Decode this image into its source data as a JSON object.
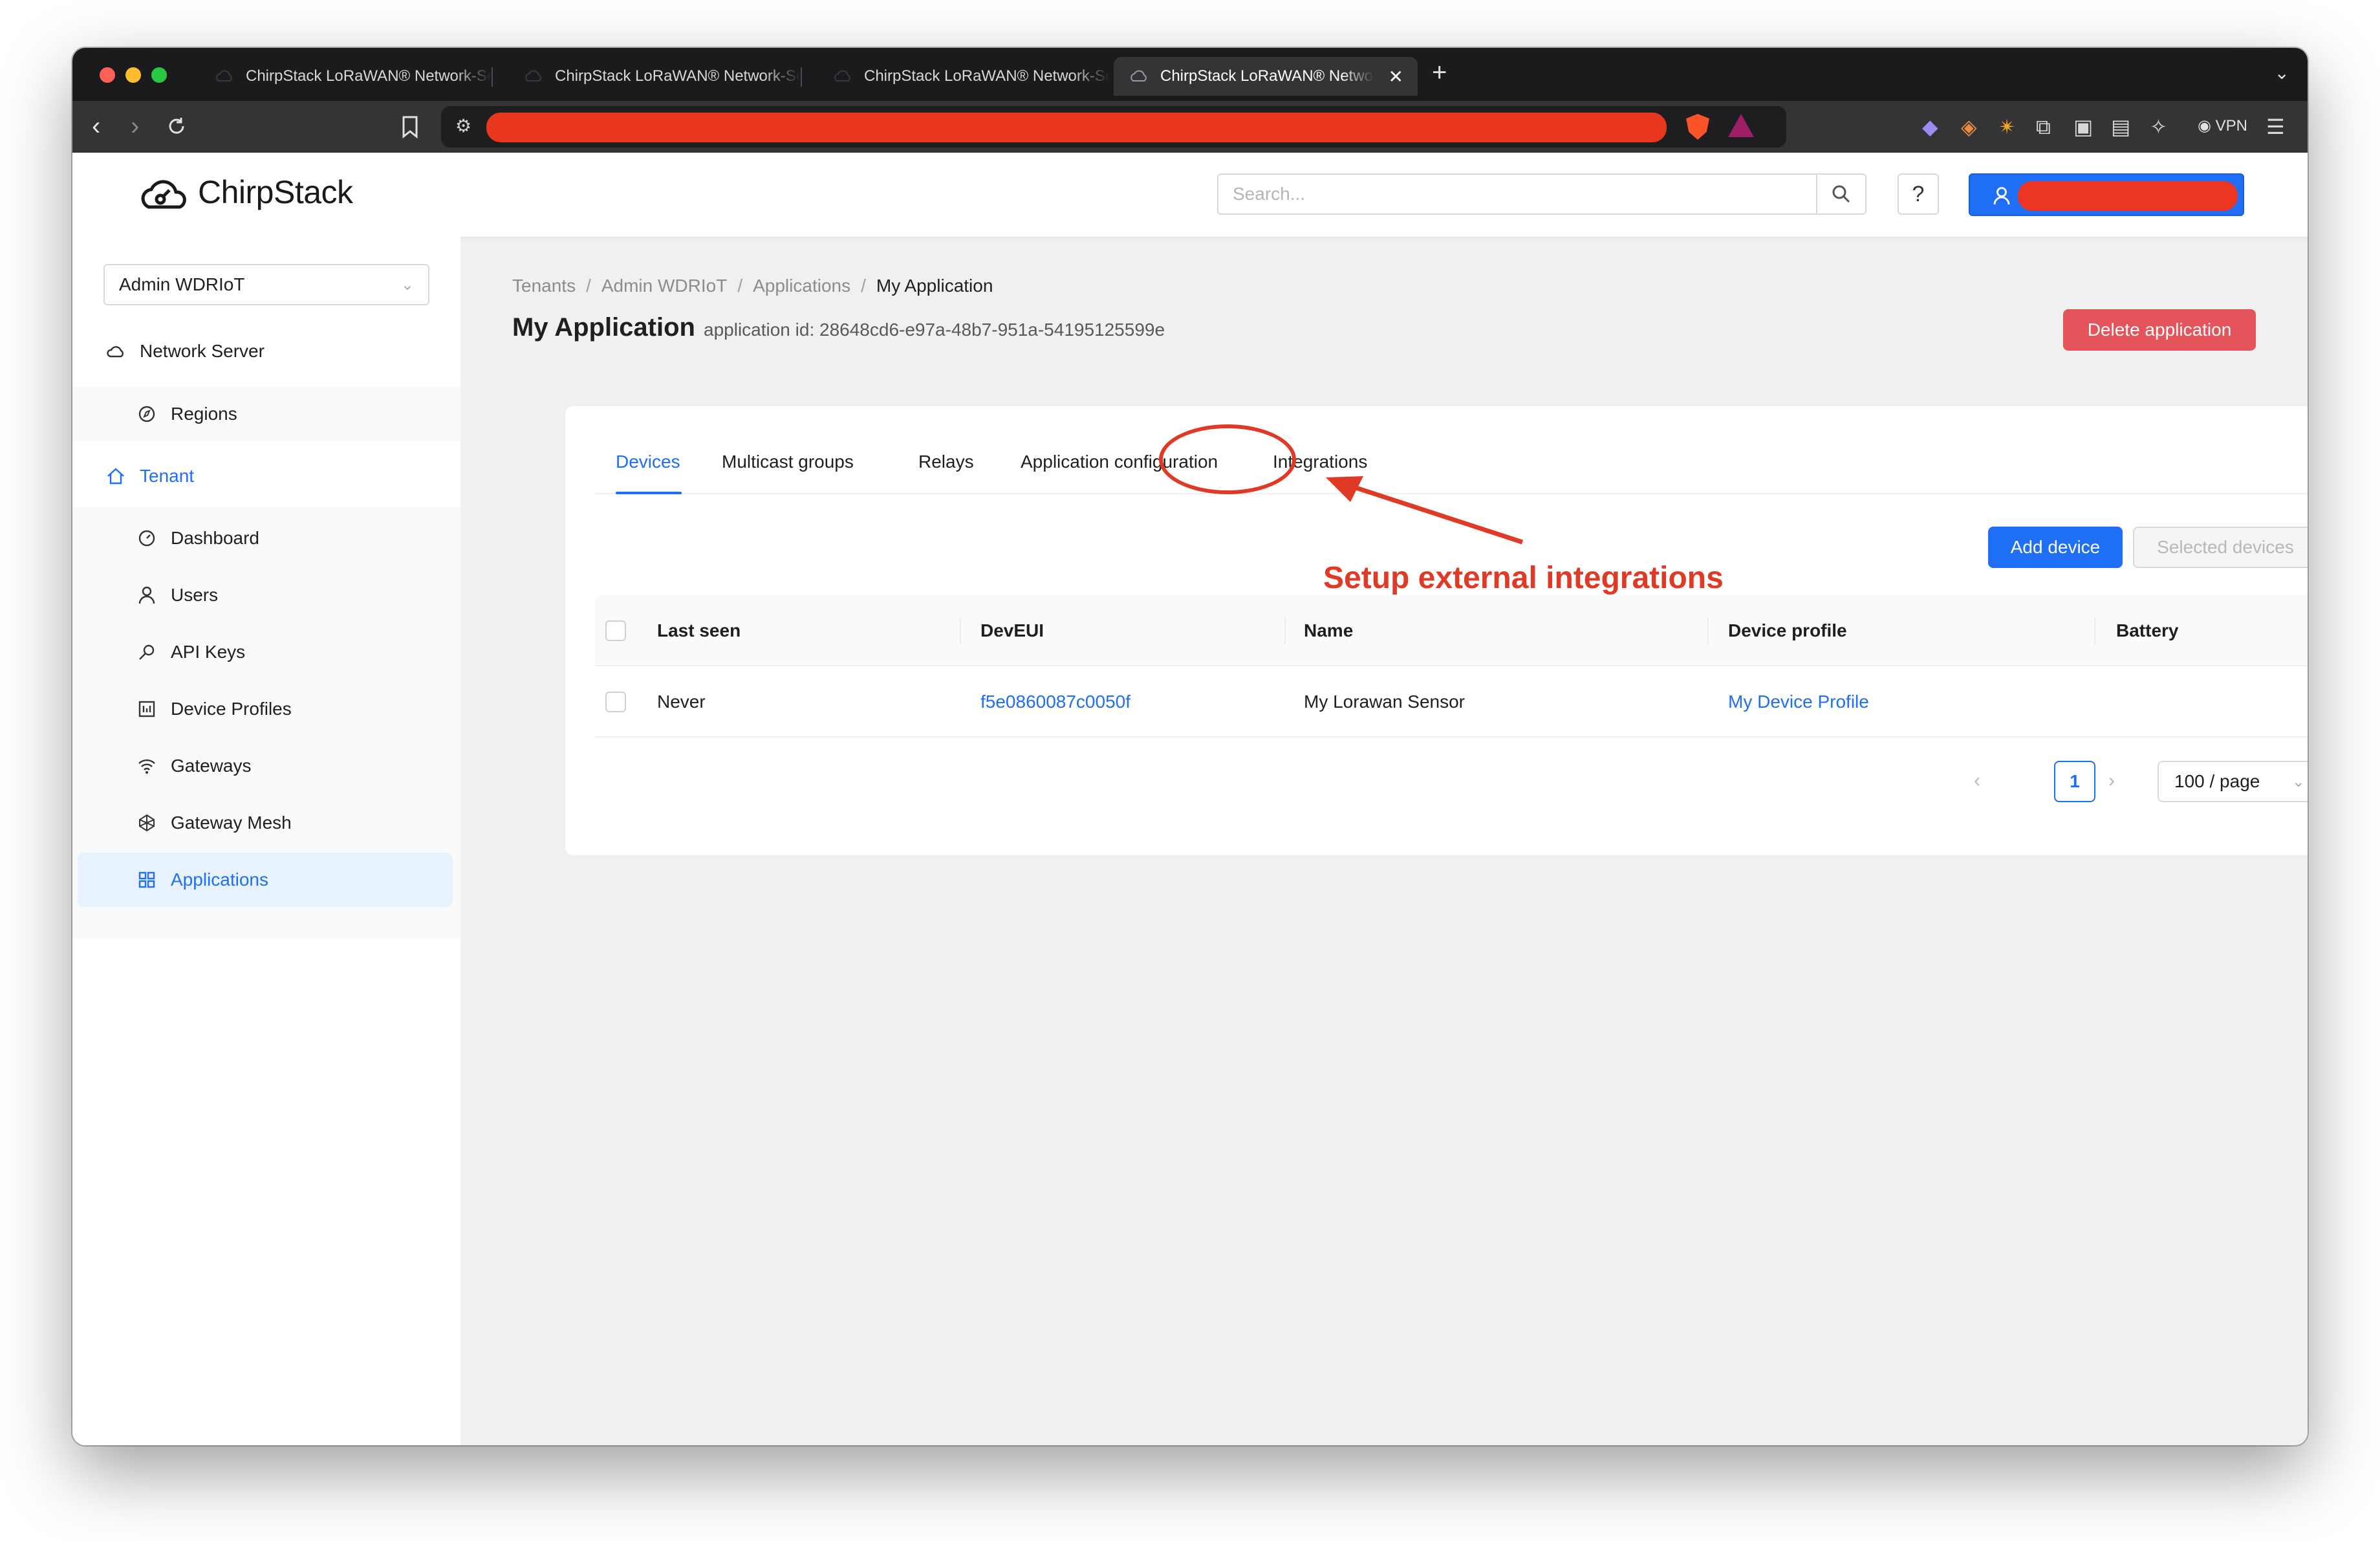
{
  "browser": {
    "tabs": [
      {
        "title": "ChirpStack LoRaWAN® Network-Server"
      },
      {
        "title": "ChirpStack LoRaWAN® Network-Server"
      },
      {
        "title": "ChirpStack LoRaWAN® Network-Server"
      },
      {
        "title": "ChirpStack LoRaWAN® Network-Server",
        "active": true
      }
    ],
    "vpn_label": "VPN",
    "icons": [
      "back-icon",
      "forward-icon",
      "reload-icon",
      "bookmark-icon",
      "site-settings-icon",
      "brave-shields-icon",
      "brave-rewards-icon",
      "extensions-icon",
      "sidebar-icon",
      "wallet-icon",
      "leo-icon",
      "menu-icon"
    ]
  },
  "header": {
    "logo_text": "ChirpStack",
    "search_placeholder": "Search...",
    "help_label": "?"
  },
  "sidebar": {
    "tenant_select": "Admin WDRIoT",
    "network_server": "Network Server",
    "regions": "Regions",
    "tenant": "Tenant",
    "items": [
      {
        "label": "Dashboard",
        "icon": "dashboard-icon"
      },
      {
        "label": "Users",
        "icon": "user-icon"
      },
      {
        "label": "API Keys",
        "icon": "key-icon"
      },
      {
        "label": "Device Profiles",
        "icon": "device-profile-icon"
      },
      {
        "label": "Gateways",
        "icon": "wifi-icon"
      },
      {
        "label": "Gateway Mesh",
        "icon": "mesh-icon"
      },
      {
        "label": "Applications",
        "icon": "grid-icon",
        "selected": true
      }
    ]
  },
  "page": {
    "breadcrumb": [
      "Tenants",
      "Admin WDRIoT",
      "Applications",
      "My Application"
    ],
    "title": "My Application",
    "subtitle": "application id: 28648cd6-e97a-48b7-951a-54195125599e",
    "delete_label": "Delete application",
    "tabs": [
      "Devices",
      "Multicast groups",
      "Relays",
      "Application configuration",
      "Integrations"
    ],
    "active_tab": "Devices",
    "add_device_label": "Add device",
    "selected_devices_label": "Selected devices",
    "table": {
      "columns": [
        "Last seen",
        "DevEUI",
        "Name",
        "Device profile",
        "Battery"
      ],
      "rows": [
        {
          "last_seen": "Never",
          "dev_eui": "f5e0860087c0050f",
          "name": "My Lorawan Sensor",
          "device_profile": "My Device Profile",
          "battery": ""
        }
      ]
    },
    "pagination": {
      "current": "1",
      "page_size": "100 / page"
    }
  },
  "annotation": {
    "text": "Setup external integrations",
    "color": "#e03a26"
  },
  "colors": {
    "accent": "#1e6ef6",
    "danger": "#e5535b",
    "annotation": "#e03a26"
  }
}
